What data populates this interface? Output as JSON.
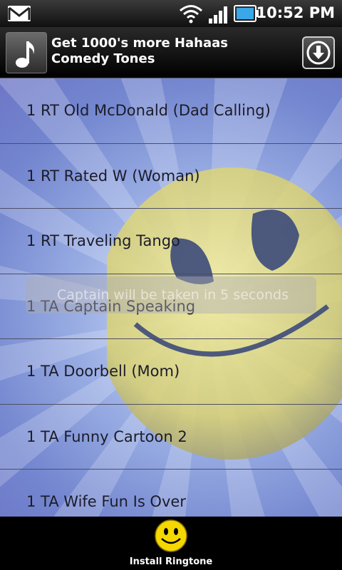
{
  "status_bar": {
    "time": "10:52 PM",
    "icons": [
      "gmail-icon",
      "wifi-icon",
      "signal-icon",
      "battery-icon"
    ]
  },
  "promo": {
    "title_line1": "Get 1000's more Hahaas",
    "title_line2": "Comedy Tones",
    "icon": "music-note-icon",
    "action_icon": "download-icon"
  },
  "ringtones": [
    {
      "label": "1 RT Old McDonald (Dad Calling)"
    },
    {
      "label": "1 RT Rated W (Woman)"
    },
    {
      "label": "1 RT Traveling Tango"
    },
    {
      "label": "1 TA Captain Speaking"
    },
    {
      "label": "1 TA Doorbell (Mom)"
    },
    {
      "label": "1 TA Funny Cartoon 2"
    },
    {
      "label": "1 TA Wife Fun Is Over"
    }
  ],
  "toast": {
    "text": "Captain will be taken in 5 seconds"
  },
  "bottom_bar": {
    "install_label": "Install Ringtone",
    "install_icon": "smiley-icon"
  },
  "colors": {
    "background_blue": "#7386cf",
    "smiley_yellow": "#e8d84a"
  }
}
